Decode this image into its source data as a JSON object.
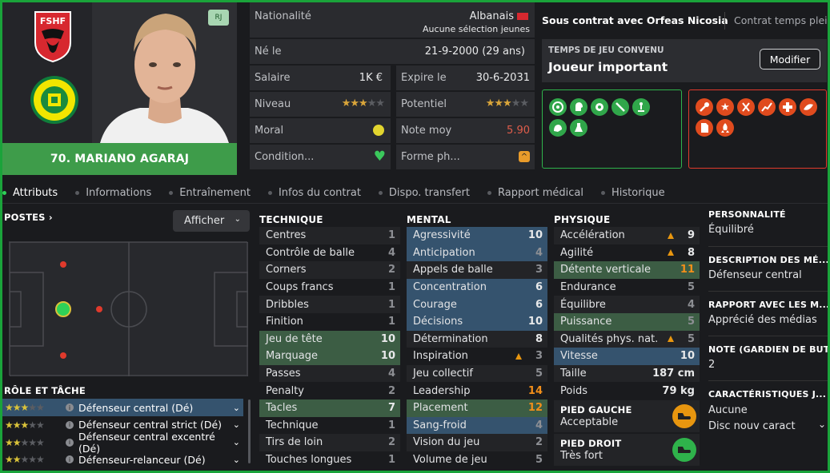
{
  "player": {
    "name": "70. MARIANO AGARAJ",
    "tag": "RJ",
    "club_badge_text": "FSHF"
  },
  "info": {
    "nationality_label": "Nationalité",
    "nationality_value": "Albanais",
    "youth_selection": "Aucune sélection jeunes",
    "born_label": "Né le",
    "born_value": "21-9-2000 (29 ans)",
    "salary_label": "Salaire",
    "salary_value": "1K €",
    "expires_label": "Expire le",
    "expires_value": "30-6-2031",
    "level_label": "Niveau",
    "potential_label": "Potentiel",
    "morale_label": "Moral",
    "avg_rating_label": "Note moy",
    "avg_rating_value": "5.90",
    "condition_label": "Condition...",
    "form_label": "Forme ph..."
  },
  "contract": {
    "status": "Sous contrat avec Orfeas Nicosia",
    "type": "Contrat temps plein",
    "playtime_title": "TEMPS DE JEU CONVENU",
    "playtime_value": "Joueur important",
    "modify_button": "Modifier"
  },
  "tabs": [
    "Attributs",
    "Informations",
    "Entraînement",
    "Infos du contrat",
    "Dispo. transfert",
    "Rapport médical",
    "Historique"
  ],
  "positions": {
    "title": "POSTES",
    "show_button": "Afficher"
  },
  "role": {
    "title": "RÔLE ET TÂCHE",
    "items": [
      {
        "label": "Défenseur central (Dé)",
        "stars": 3
      },
      {
        "label": "Défenseur central strict (Dé)",
        "stars": 3
      },
      {
        "label": "Défenseur central excentré (Dé)",
        "stars": 2
      },
      {
        "label": "Défenseur-relanceur (Dé)",
        "stars": 2
      }
    ]
  },
  "technique": {
    "title": "TECHNIQUE",
    "rows": [
      {
        "name": "Centres",
        "value": "1"
      },
      {
        "name": "Contrôle de balle",
        "value": "4"
      },
      {
        "name": "Corners",
        "value": "2"
      },
      {
        "name": "Coups francs",
        "value": "1"
      },
      {
        "name": "Dribbles",
        "value": "1"
      },
      {
        "name": "Finition",
        "value": "1"
      },
      {
        "name": "Jeu de tête",
        "value": "10"
      },
      {
        "name": "Marquage",
        "value": "10"
      },
      {
        "name": "Passes",
        "value": "4"
      },
      {
        "name": "Penalty",
        "value": "2"
      },
      {
        "name": "Tacles",
        "value": "7"
      },
      {
        "name": "Technique",
        "value": "1"
      },
      {
        "name": "Tirs de loin",
        "value": "2"
      },
      {
        "name": "Touches longues",
        "value": "1"
      }
    ]
  },
  "mental": {
    "title": "MENTAL",
    "rows": [
      {
        "name": "Agressivité",
        "value": "10"
      },
      {
        "name": "Anticipation",
        "value": "4"
      },
      {
        "name": "Appels de balle",
        "value": "3"
      },
      {
        "name": "Concentration",
        "value": "6"
      },
      {
        "name": "Courage",
        "value": "6"
      },
      {
        "name": "Décisions",
        "value": "10"
      },
      {
        "name": "Détermination",
        "value": "8"
      },
      {
        "name": "Inspiration",
        "value": "3"
      },
      {
        "name": "Jeu collectif",
        "value": "5"
      },
      {
        "name": "Leadership",
        "value": "14"
      },
      {
        "name": "Placement",
        "value": "12"
      },
      {
        "name": "Sang-froid",
        "value": "4"
      },
      {
        "name": "Vision du jeu",
        "value": "2"
      },
      {
        "name": "Volume de jeu",
        "value": "5"
      }
    ]
  },
  "physique": {
    "title": "PHYSIQUE",
    "rows": [
      {
        "name": "Accélération",
        "value": "9"
      },
      {
        "name": "Agilité",
        "value": "8"
      },
      {
        "name": "Détente verticale",
        "value": "11"
      },
      {
        "name": "Endurance",
        "value": "5"
      },
      {
        "name": "Équilibre",
        "value": "4"
      },
      {
        "name": "Puissance",
        "value": "5"
      },
      {
        "name": "Qualités phys. nat.",
        "value": "5"
      },
      {
        "name": "Vitesse",
        "value": "10"
      },
      {
        "name": "Taille",
        "value": "187 cm"
      },
      {
        "name": "Poids",
        "value": "79 kg"
      }
    ],
    "left_foot_title": "PIED GAUCHE",
    "left_foot_value": "Acceptable",
    "right_foot_title": "PIED DROIT",
    "right_foot_value": "Très fort"
  },
  "side": {
    "personality_title": "PERSONNALITÉ",
    "personality_value": "Équilibré",
    "description_title": "DESCRIPTION DES MÉ...",
    "description_value": "Défenseur central",
    "media_title": "RAPPORT AVEC LES M...",
    "media_value": "Apprécié des médias",
    "gk_title": "NOTE (GARDIEN DE BUT)",
    "gk_value": "2",
    "traits_title": "CARACTÉRISTIQUES J...",
    "traits_value": "Aucune",
    "traits_sub": "Disc nouv caract"
  },
  "colors": {
    "accent_green": "#1aa33a",
    "name_bar": "#3e9c4a",
    "highlight_green": "#3c5d44",
    "highlight_blue": "#35536e",
    "orange": "#f28f1a",
    "red": "#e03a2c"
  }
}
